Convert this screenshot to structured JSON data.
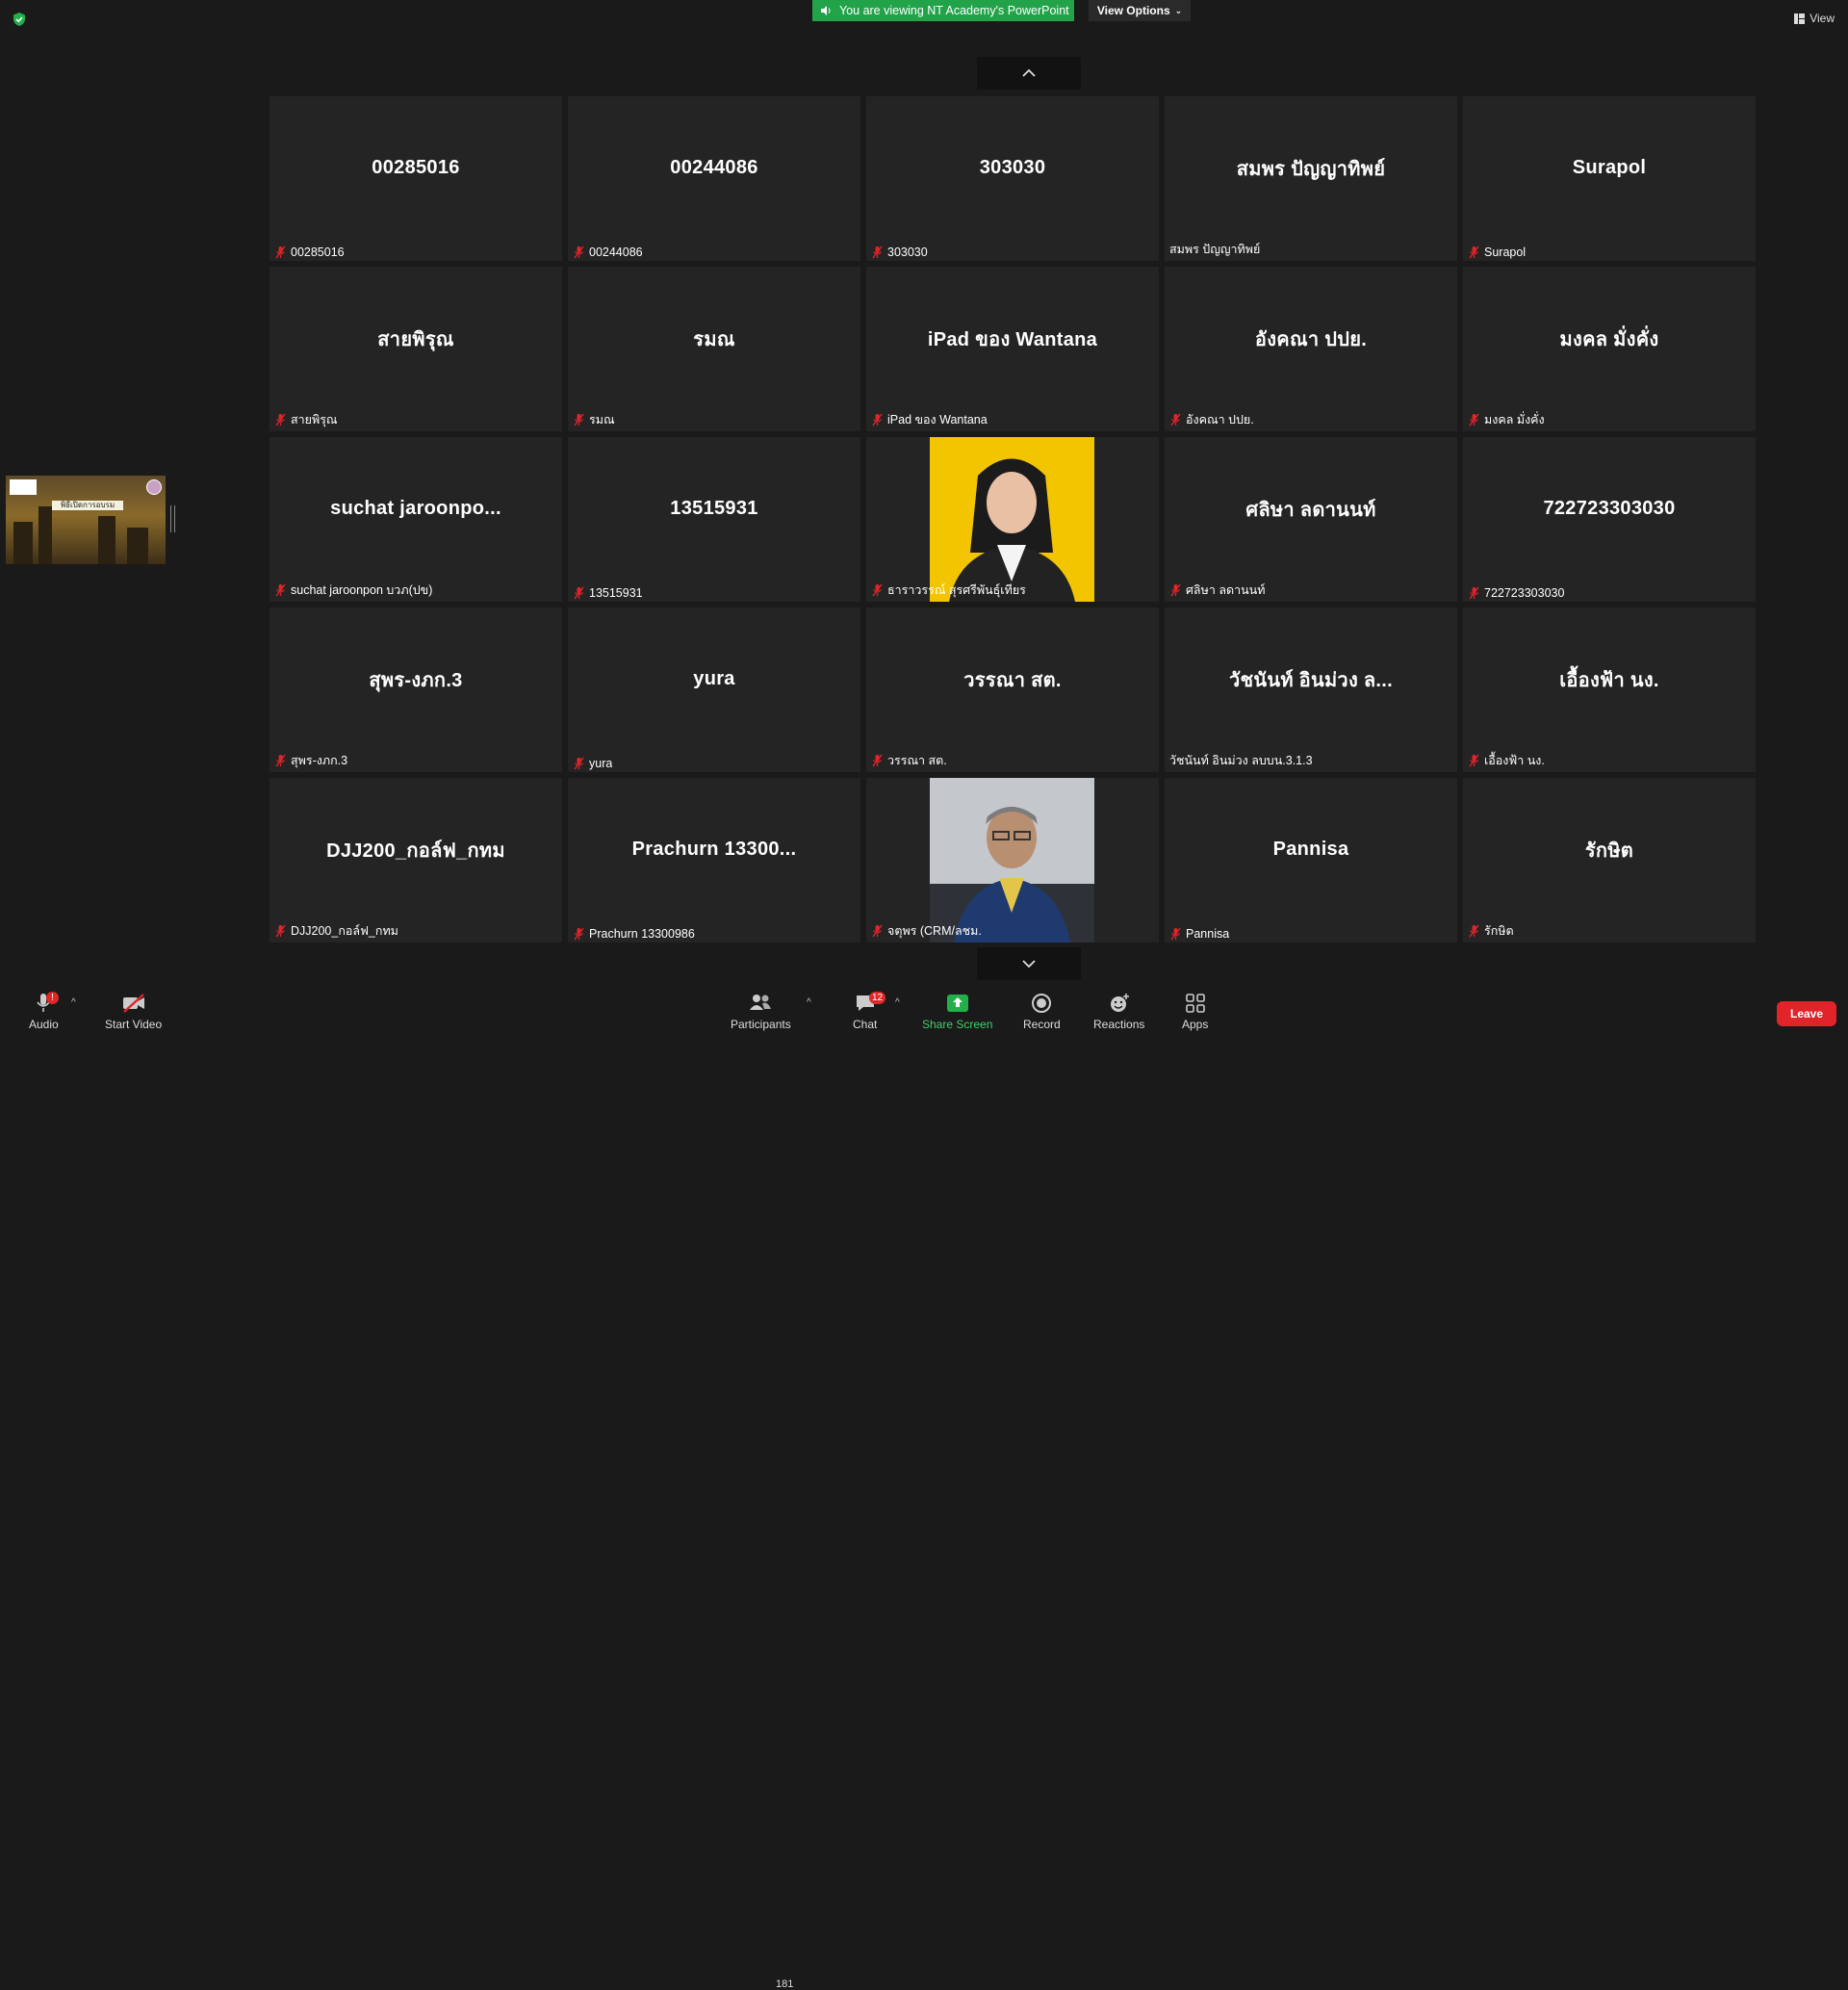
{
  "banner": {
    "text": "You are viewing NT Academy's PowerPoint",
    "view_options": "View Options",
    "view_label": "View"
  },
  "self_view": {
    "slide_title": "พิธีเปิดการอบรม"
  },
  "tiles": [
    {
      "center": "00285016",
      "label": "00285016",
      "muted": true
    },
    {
      "center": "00244086",
      "label": "00244086",
      "muted": true
    },
    {
      "center": "303030",
      "label": "303030",
      "muted": true
    },
    {
      "center": "สมพร ปัญญาทิพย์",
      "label": "สมพร ปัญญาทิพย์",
      "muted": false
    },
    {
      "center": "Surapol",
      "label": "Surapol",
      "muted": true
    },
    {
      "center": "สายพิรุณ",
      "label": "สายพิรุณ",
      "muted": true
    },
    {
      "center": "รมณ",
      "label": "รมณ",
      "muted": true
    },
    {
      "center": "iPad ของ Wantana",
      "label": "iPad ของ Wantana",
      "muted": true
    },
    {
      "center": "อังคณา   ปปย.",
      "label": "อังคณา   ปปย.",
      "muted": true
    },
    {
      "center": "มงคล มั่งคั่ง",
      "label": "มงคล มั่งคั่ง",
      "muted": true
    },
    {
      "center": "suchat jaroonpo...",
      "label": "suchat jaroonpon บวภ(ปข)",
      "muted": true
    },
    {
      "center": "13515931",
      "label": "13515931",
      "muted": true
    },
    {
      "center": "",
      "label": "ธาราวรรณ์ สุรศรีพันธุ์เทียร",
      "muted": true,
      "video": "yellow"
    },
    {
      "center": "ศลิษา ลดานนท์",
      "label": "ศลิษา ลดานนท์",
      "muted": true
    },
    {
      "center": "722723303030",
      "label": "722723303030",
      "muted": true
    },
    {
      "center": "สุพร-งภก.3",
      "label": "สุพร-งภก.3",
      "muted": true
    },
    {
      "center": "yura",
      "label": "yura",
      "muted": true
    },
    {
      "center": "วรรณา สต.",
      "label": "วรรณา สต.",
      "muted": true
    },
    {
      "center": "วัชนันท์ อินม่วง ล...",
      "label": "วัชนันท์ อินม่วง ลบบน.3.1.3",
      "muted": false
    },
    {
      "center": "เอื้องฟ้า นง.",
      "label": "เอื้องฟ้า นง.",
      "muted": true
    },
    {
      "center": "DJJ200_กอล์ฟ_กทม",
      "label": "DJJ200_กอล์ฟ_กทม",
      "muted": true
    },
    {
      "center": "Prachurn 13300...",
      "label": "Prachurn 13300986",
      "muted": true
    },
    {
      "center": "",
      "label": "จตุพร (CRM/ลชม.",
      "muted": true,
      "video": "gray"
    },
    {
      "center": "Pannisa",
      "label": "Pannisa",
      "muted": true
    },
    {
      "center": "รักษิต",
      "label": "รักษิต",
      "muted": true
    }
  ],
  "toolbar": {
    "audio": "Audio",
    "audio_badge": "!",
    "start_video": "Start Video",
    "participants": "Participants",
    "participants_count": "181",
    "chat": "Chat",
    "chat_badge": "12",
    "share_screen": "Share Screen",
    "record": "Record",
    "reactions": "Reactions",
    "apps": "Apps",
    "leave": "Leave"
  },
  "colors": {
    "banner_green": "#22a34a",
    "muted_red": "#e0242a",
    "share_green": "#3ed16b",
    "tile_bg": "#242424"
  }
}
